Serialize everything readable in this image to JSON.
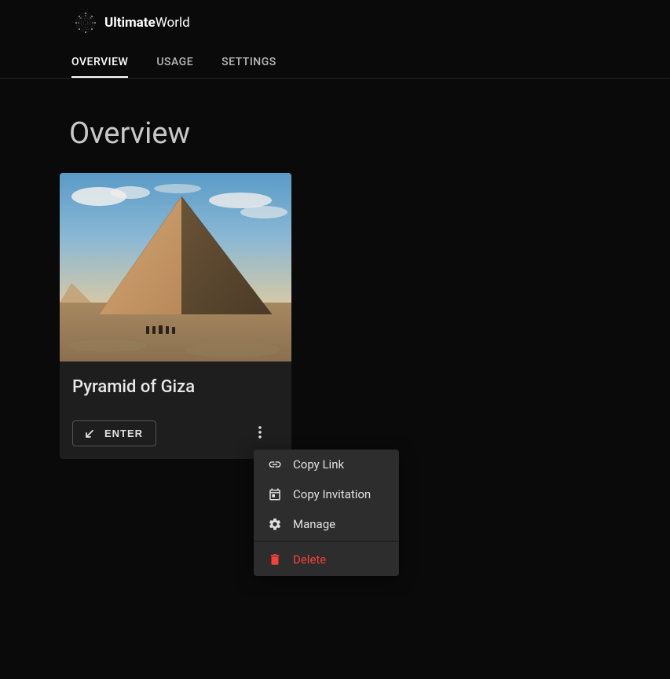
{
  "logo": {
    "text_bold": "Ultimate",
    "text_light": "World"
  },
  "tabs": [
    {
      "label": "Overview",
      "active": true
    },
    {
      "label": "Usage",
      "active": false
    },
    {
      "label": "Settings",
      "active": false
    }
  ],
  "page": {
    "title": "Overview"
  },
  "card": {
    "title": "Pyramid of Giza",
    "enter_label": "ENTER"
  },
  "menu": {
    "copy_link": "Copy Link",
    "copy_invitation": "Copy Invitation",
    "manage": "Manage",
    "delete": "Delete"
  }
}
